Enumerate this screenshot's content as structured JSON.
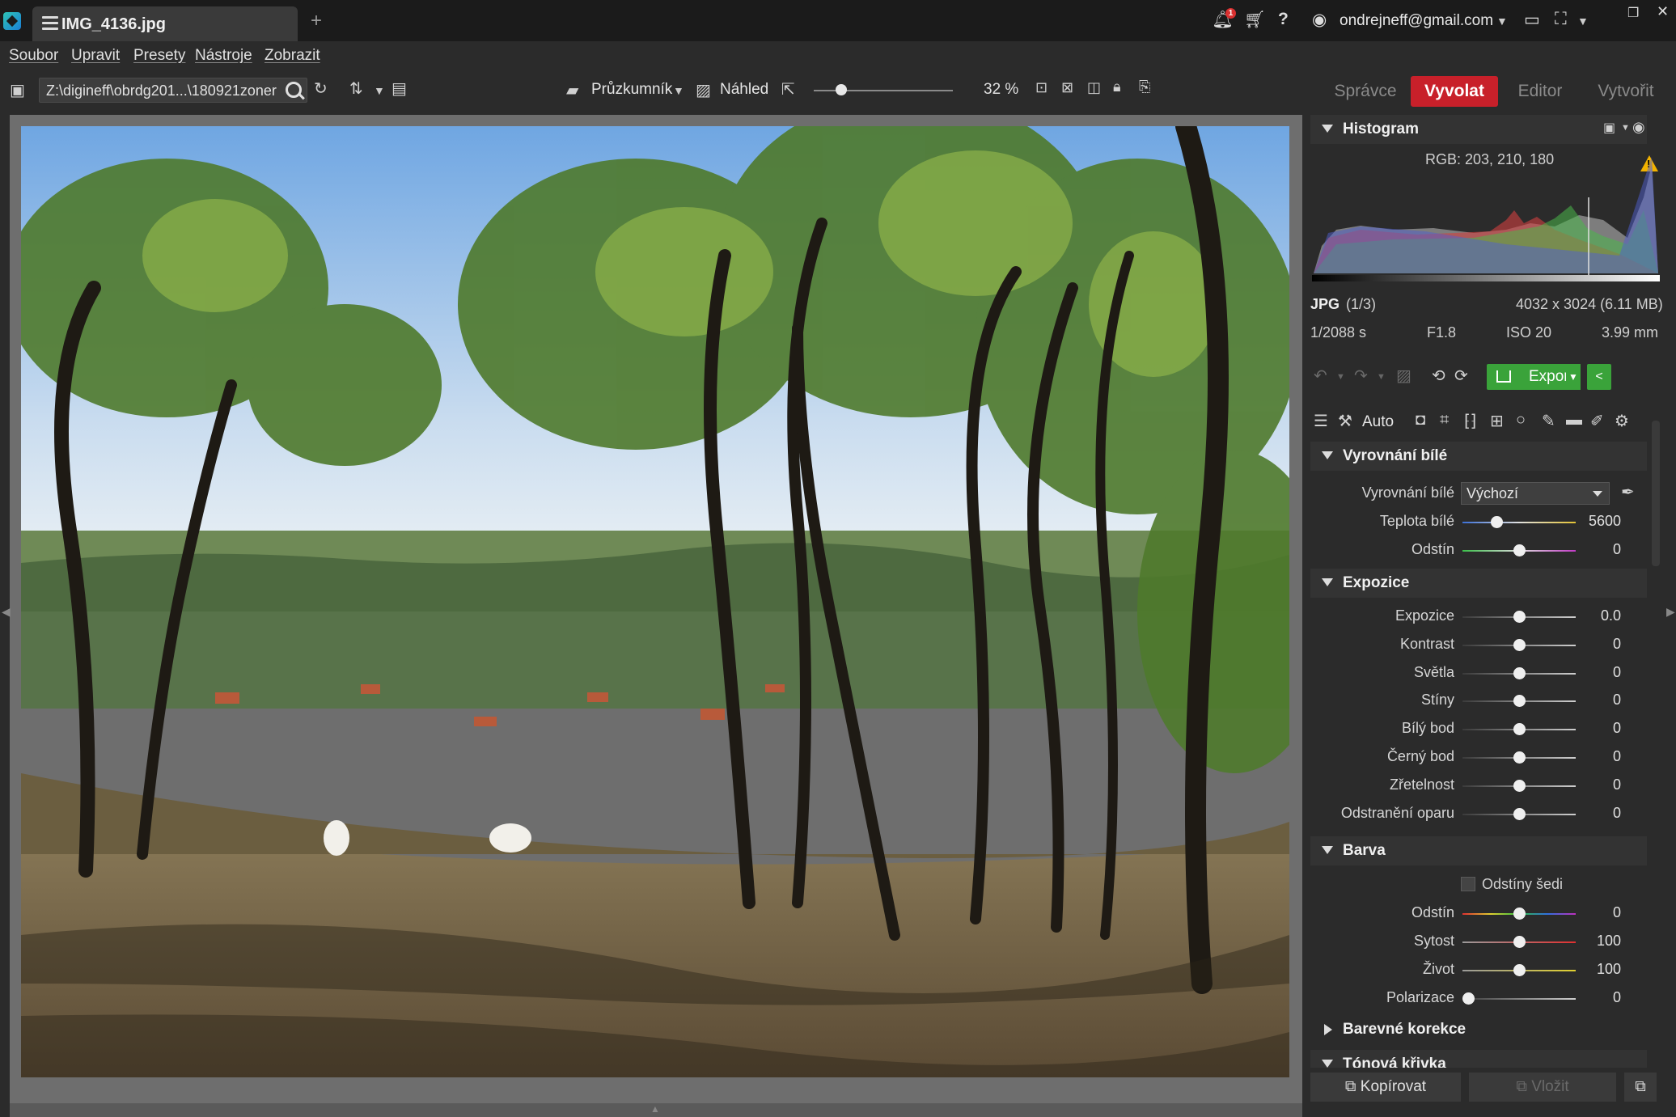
{
  "titlebar": {
    "tab_title": "IMG_4136.jpg",
    "add_tab": "+",
    "notification_count": "1",
    "user_email": "ondrejneff@gmail.com"
  },
  "menu": [
    "Soubor",
    "Upravit",
    "Presety",
    "Nástroje",
    "Zobrazit"
  ],
  "toolbar": {
    "path": "Z:\\diginеff\\obrdg201...\\180921zoner",
    "explorer_label": "Průzkumník",
    "preview_label": "Náhled",
    "zoom": "32 %",
    "zoom_fraction": 0.32
  },
  "modules": [
    {
      "label": "Správce",
      "active": false
    },
    {
      "label": "Vyvolat",
      "active": true
    },
    {
      "label": "Editor",
      "active": false
    },
    {
      "label": "Vytvořit",
      "active": false
    }
  ],
  "histogram": {
    "title": "Histogram",
    "rgb": "RGB: 203, 210, 180"
  },
  "file_info": {
    "format": "JPG",
    "index": "(1/3)",
    "dimensions": "4032 x 3024 (6.11 MB)",
    "shutter": "1/2088 s",
    "aperture": "F1.8",
    "iso": "ISO 20",
    "focal": "3.99 mm"
  },
  "actions": {
    "export_label": "Export",
    "auto_label": "Auto",
    "copy_label": "Kopírovat",
    "paste_label": "Vložit"
  },
  "white_balance": {
    "title": "Vyrovnání bílé",
    "mode_label": "Vyrovnání bílé",
    "mode_value": "Výchozí",
    "params": [
      {
        "label": "Teplota bílé",
        "value": "5600",
        "pos": 0.3,
        "track": "temp"
      },
      {
        "label": "Odstín",
        "value": "0",
        "pos": 0.5,
        "track": "tint"
      }
    ]
  },
  "exposure": {
    "title": "Expozice",
    "params": [
      {
        "label": "Expozice",
        "value": "0.0",
        "pos": 0.5
      },
      {
        "label": "Kontrast",
        "value": "0",
        "pos": 0.5
      },
      {
        "label": "Světla",
        "value": "0",
        "pos": 0.5
      },
      {
        "label": "Stíny",
        "value": "0",
        "pos": 0.5
      },
      {
        "label": "Bílý bod",
        "value": "0",
        "pos": 0.5
      },
      {
        "label": "Černý bod",
        "value": "0",
        "pos": 0.5
      },
      {
        "label": "Zřetelnost",
        "value": "0",
        "pos": 0.5
      },
      {
        "label": "Odstranění oparu",
        "value": "0",
        "pos": 0.5
      }
    ]
  },
  "color": {
    "title": "Barva",
    "grayscale_label": "Odstíny šedi",
    "params": [
      {
        "label": "Odstín",
        "value": "0",
        "pos": 0.5,
        "track": "hue"
      },
      {
        "label": "Sytost",
        "value": "100",
        "pos": 0.5,
        "track": "sat"
      },
      {
        "label": "Život",
        "value": "100",
        "pos": 0.5,
        "track": "vib"
      },
      {
        "label": "Polarizace",
        "value": "0",
        "pos": 0.05
      }
    ]
  },
  "color_corrections": {
    "title": "Barevné korekce"
  },
  "tone_curve": {
    "title": "Tónová křivka"
  },
  "colors": {
    "accent": "#c8202a",
    "export_green": "#3aa33a",
    "warning": "#f2b200"
  }
}
